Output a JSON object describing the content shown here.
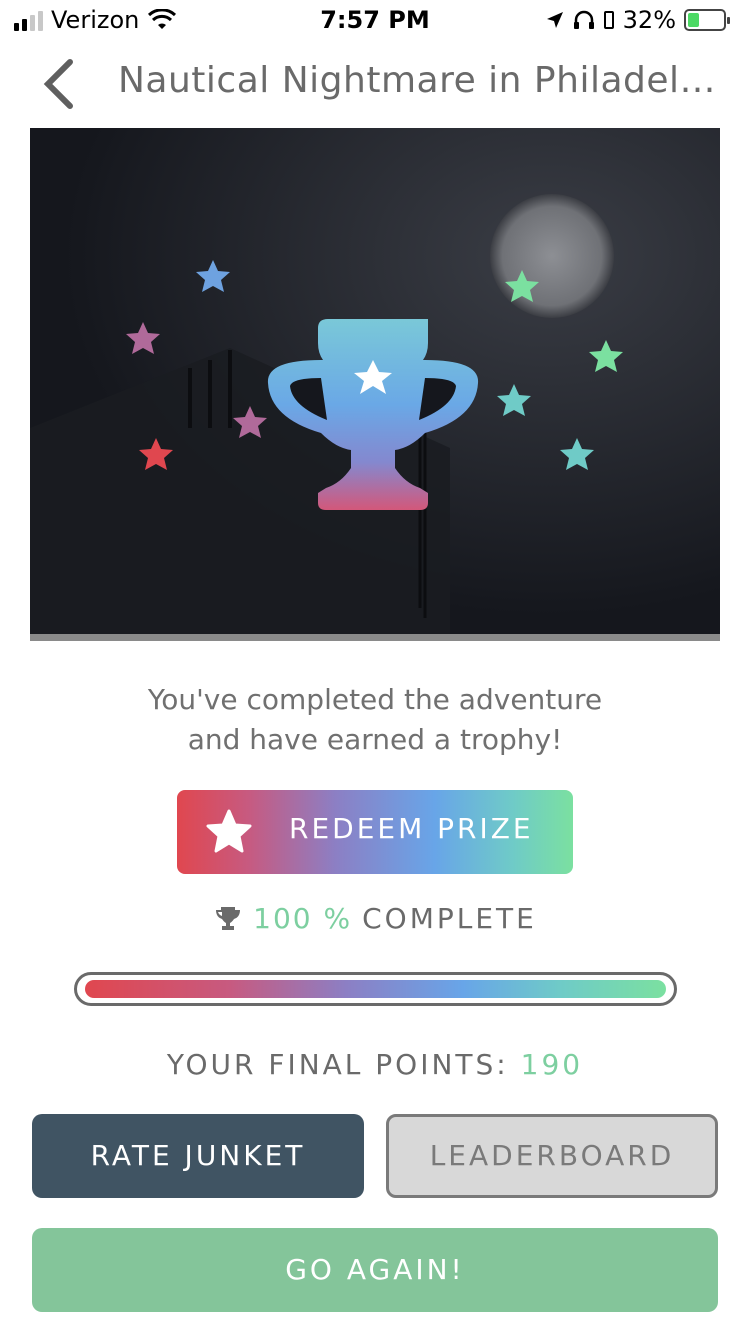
{
  "status_bar": {
    "carrier": "Verizon",
    "time": "7:57 PM",
    "battery_percent": "32%",
    "battery_level": 0.32
  },
  "nav": {
    "title": "Nautical Nightmare in Philadelp..."
  },
  "main": {
    "completion_line1": "You've completed the adventure",
    "completion_line2": "and have earned a trophy!",
    "redeem_label": "REDEEM PRIZE",
    "progress_value": "100 %",
    "progress_label": "COMPLETE",
    "progress_fraction": 1.0,
    "points_label": "YOUR FINAL POINTS:",
    "points_value": "190"
  },
  "buttons": {
    "rate": "RATE JUNKET",
    "leaderboard": "LEADERBOARD",
    "go_again": "GO AGAIN!"
  },
  "colors": {
    "accent_green": "#7dcfa0",
    "slate": "#405463",
    "gradient_start": "#e0474f",
    "gradient_mid": "#68a5e8",
    "gradient_end": "#7be0a0"
  },
  "icons": {
    "back": "chevron-left-icon",
    "trophy": "trophy-icon",
    "star": "star-icon"
  }
}
